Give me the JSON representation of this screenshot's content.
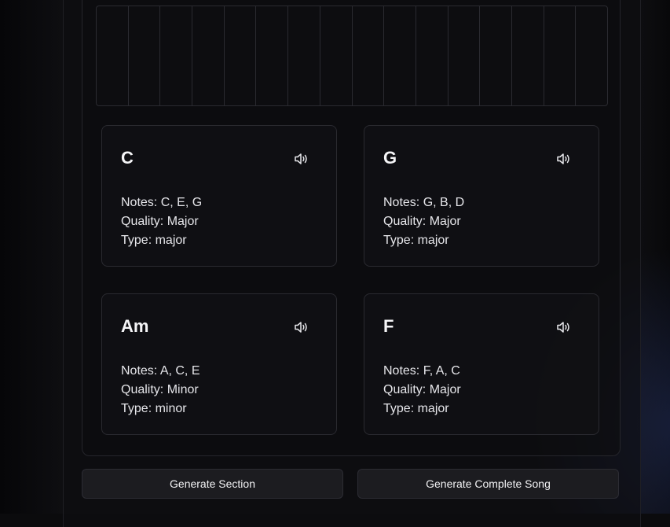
{
  "keyboard": {
    "key_count": 16
  },
  "chords": [
    {
      "name": "C",
      "notes_label": "Notes:",
      "notes": "C, E, G",
      "quality_label": "Quality:",
      "quality": "Major",
      "type_label": "Type:",
      "type": "major"
    },
    {
      "name": "G",
      "notes_label": "Notes:",
      "notes": "G, B, D",
      "quality_label": "Quality:",
      "quality": "Major",
      "type_label": "Type:",
      "type": "major"
    },
    {
      "name": "Am",
      "notes_label": "Notes:",
      "notes": "A, C, E",
      "quality_label": "Quality:",
      "quality": "Minor",
      "type_label": "Type:",
      "type": "minor"
    },
    {
      "name": "F",
      "notes_label": "Notes:",
      "notes": "F, A, C",
      "quality_label": "Quality:",
      "quality": "Major",
      "type_label": "Type:",
      "type": "major"
    }
  ],
  "actions": {
    "generate_section": "Generate Section",
    "generate_song": "Generate Complete Song"
  },
  "icons": {
    "play": "speaker-volume-icon"
  },
  "colors": {
    "background": "#0b0b0d",
    "card": "#101013",
    "border": "#2a2a30",
    "button": "#1c1c20",
    "text": "#f2f2f4"
  }
}
